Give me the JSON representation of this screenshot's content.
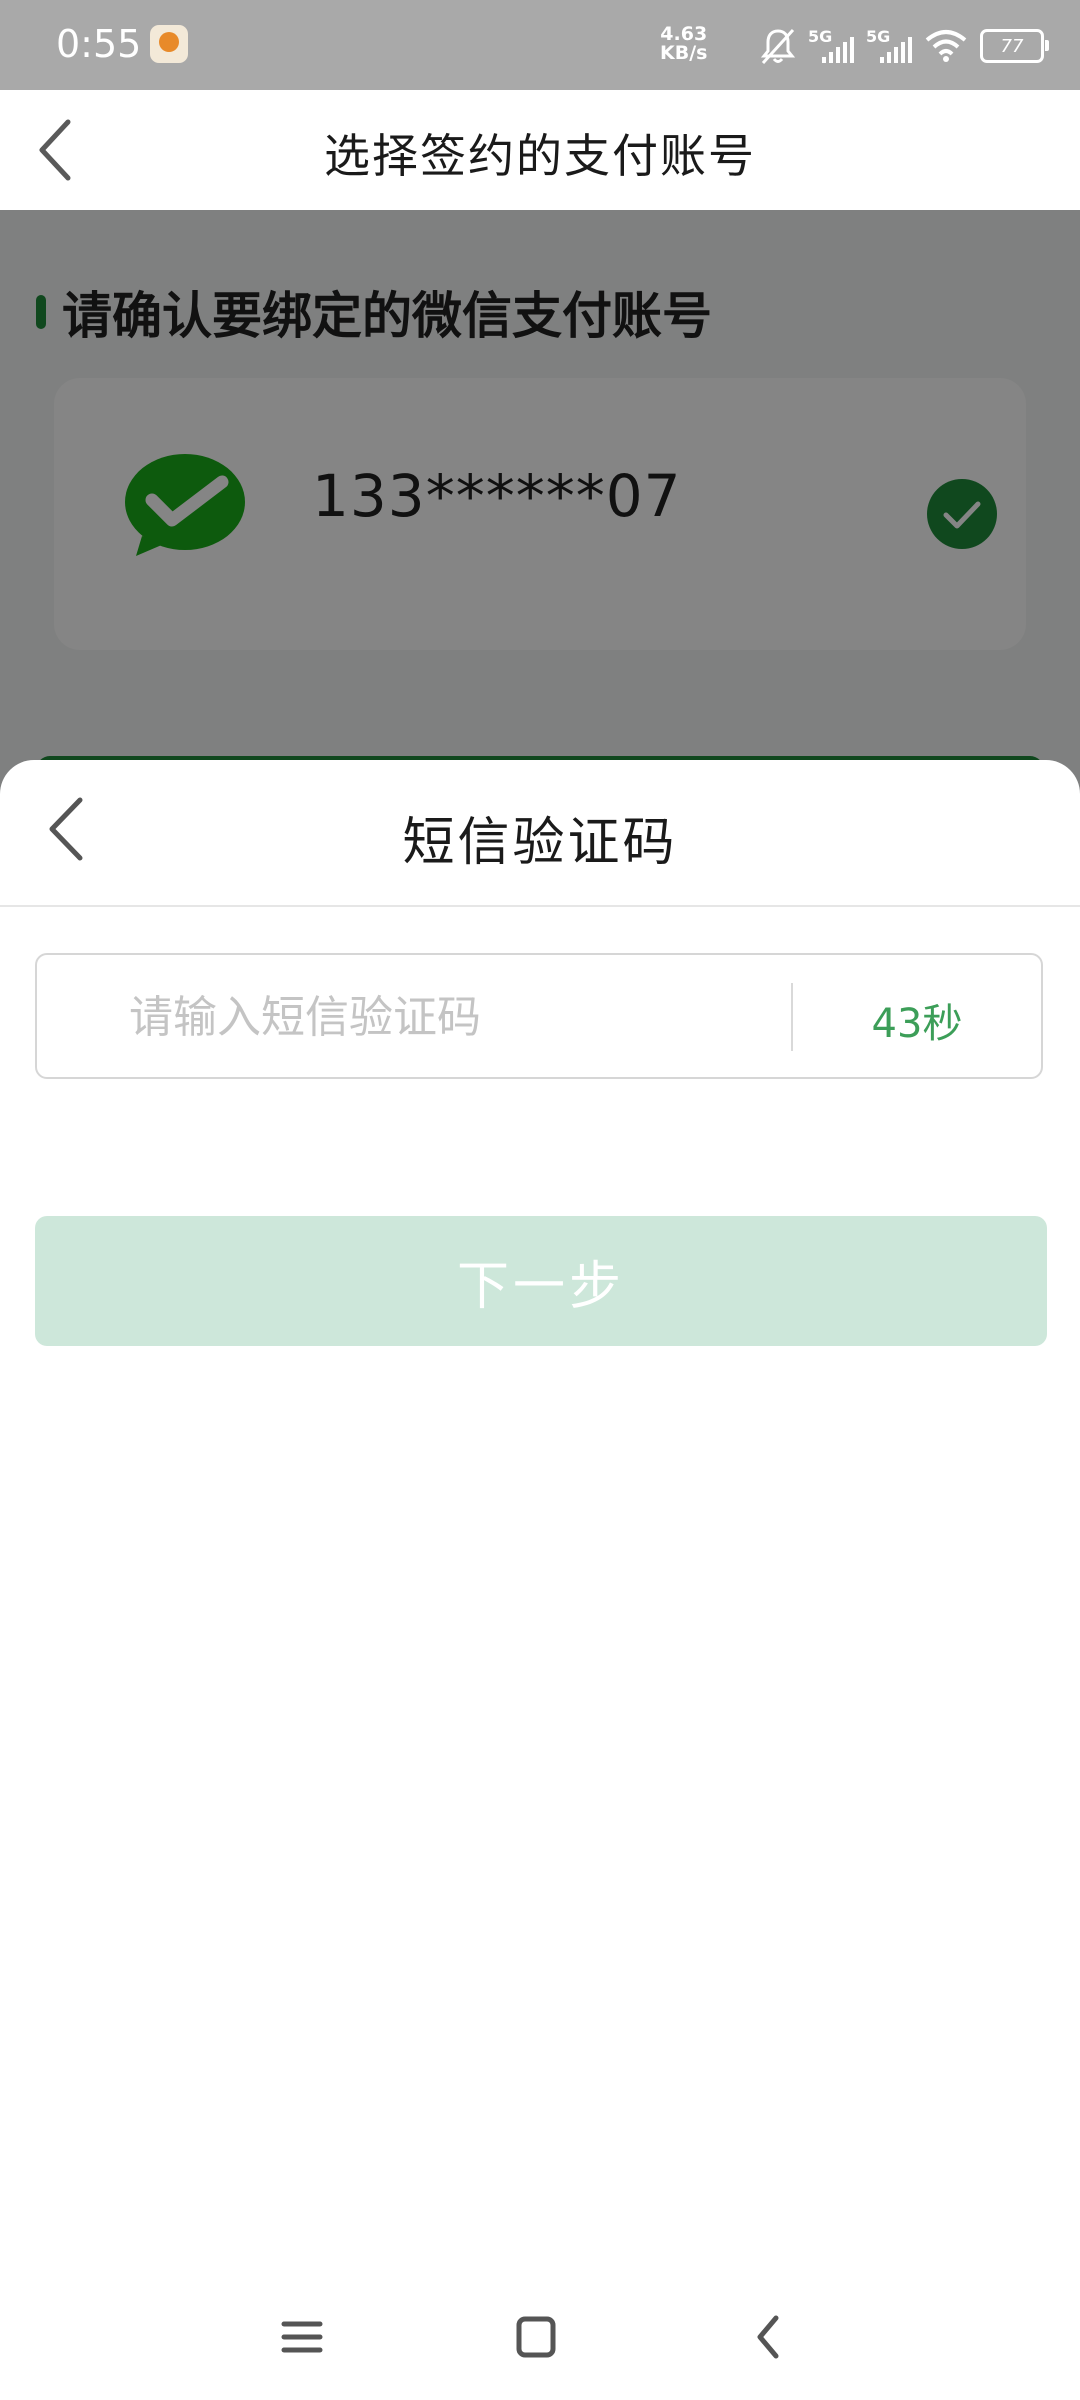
{
  "status_bar": {
    "time": "0:55",
    "net_speed_value": "4.63",
    "net_speed_unit": "KB/s",
    "signal_1": "5G",
    "signal_2": "5G",
    "battery": "77",
    "icons": [
      "app-notification-icon",
      "mute-bell-icon",
      "signal-icon",
      "wifi-icon",
      "battery-icon"
    ]
  },
  "header": {
    "title": "选择签约的支付账号",
    "back_icon": "chevron-left-icon"
  },
  "page": {
    "section_title": "请确认要绑定的微信支付账号",
    "account": {
      "number": "133******07",
      "logo_icon": "wechat-pay-icon",
      "selected_icon": "check-circle-icon"
    }
  },
  "sms_sheet": {
    "title": "短信验证码",
    "back_icon": "chevron-left-icon",
    "input_placeholder": "请输入短信验证码",
    "input_value": "",
    "countdown": "43秒",
    "next_button": "下一步"
  },
  "nav_bar": {
    "icons": [
      "menu-icon",
      "home-square-icon",
      "back-chevron-icon"
    ]
  },
  "colors": {
    "brand_green": "#1f8a3b",
    "countdown_green": "#3c9e58",
    "disabled_button": "#cde7da",
    "status_bar_bg": "#a9a9a9"
  }
}
